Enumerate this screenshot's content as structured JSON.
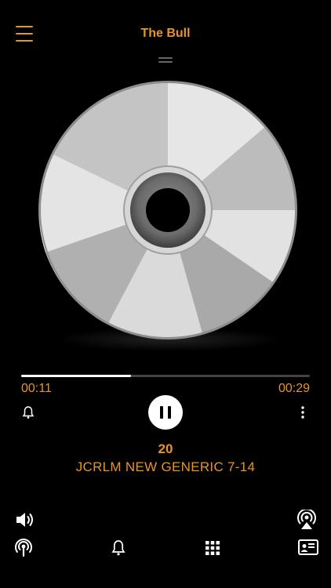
{
  "header": {
    "title": "The Bull",
    "menu_icon": "hamburger-menu-icon",
    "handle_icon": "drag-handle-icon"
  },
  "player": {
    "artwork": "compact-disc",
    "progress": 0.38,
    "elapsed": "00:11",
    "remaining": "00:29",
    "track_number": "20",
    "track_title": "JCRLM NEW GENERIC 7-14",
    "state": "playing"
  },
  "controls": {
    "alarm_icon": "bell-icon",
    "play_pause_icon": "pause-icon",
    "more_icon": "more-vertical-icon"
  },
  "bottom_bar": {
    "volume_icon": "speaker-volume-icon",
    "airplay_icon": "airplay-audio-icon",
    "items": [
      {
        "name": "podcast-icon"
      },
      {
        "name": "bell-icon"
      },
      {
        "name": "grid-icon"
      },
      {
        "name": "contact-card-icon"
      }
    ]
  },
  "colors": {
    "accent": "#e8932b",
    "background": "#000000",
    "track": "#444444"
  }
}
